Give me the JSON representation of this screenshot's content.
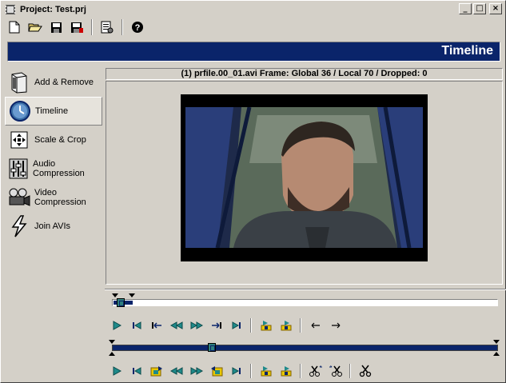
{
  "window": {
    "title": "Project: Test.prj",
    "min_label": "_",
    "max_label": "□",
    "close_label": "×"
  },
  "toolbar": {
    "icons": [
      "new-icon",
      "open-icon",
      "save-icon",
      "save-as-icon",
      "properties-icon",
      "help-icon"
    ]
  },
  "header": {
    "title": "Timeline"
  },
  "sidebar": {
    "items": [
      {
        "label": "Add & Remove",
        "icon": "book-icon"
      },
      {
        "label": "Timeline",
        "icon": "clock-icon",
        "active": true
      },
      {
        "label": "Scale & Crop",
        "icon": "move-arrows-icon"
      },
      {
        "label": "Audio Compression",
        "icon": "audio-mixer-icon"
      },
      {
        "label": "Video Compression",
        "icon": "video-camera-icon"
      },
      {
        "label": "Join AVIs",
        "icon": "lightning-icon"
      }
    ]
  },
  "video_info": "(1) prfile.00_01.avi Frame: Global 36 / Local 70 / Dropped: 0",
  "colors": {
    "accent": "#0a246a",
    "face": "#d4d0c8",
    "play_green": "#1f8a8a",
    "icon_yellow": "#e8c800"
  },
  "controls_top": [
    "play-icon",
    "first-frame-icon",
    "prev-key-icon",
    "rewind-icon",
    "fast-forward-icon",
    "next-key-icon",
    "last-frame-icon",
    "mark-in-icon",
    "mark-out-icon",
    "left-arrow-icon",
    "right-arrow-icon"
  ],
  "controls_bottom": [
    "play-icon",
    "first-frame-icon",
    "insert-frame-icon",
    "rewind-icon",
    "fast-forward-icon",
    "insert-frame-end-icon",
    "last-frame-icon",
    "mark-in-icon",
    "mark-out-icon",
    "split-left-icon",
    "split-right-icon",
    "scissors-icon"
  ]
}
